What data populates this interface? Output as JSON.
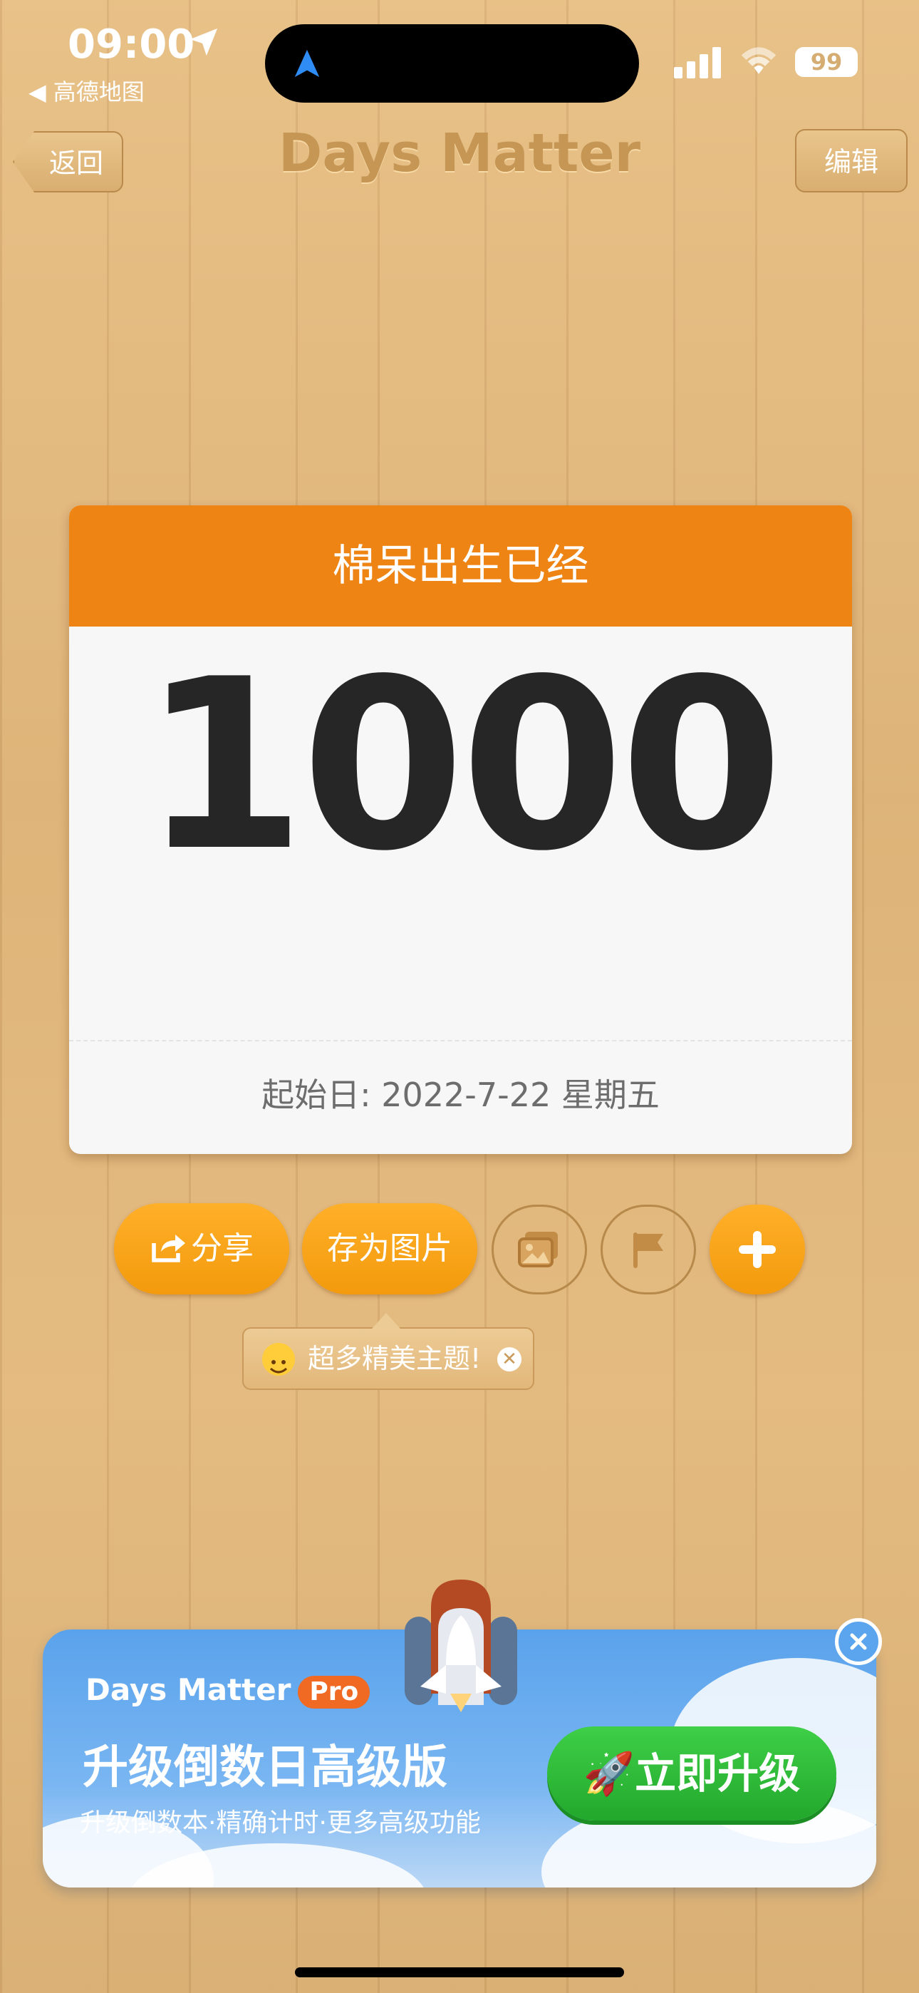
{
  "status": {
    "time": "09:00",
    "back_app": "◀ 高德地图",
    "battery": "99",
    "icons": [
      "location-arrow-icon",
      "navigation-icon",
      "signal-icon",
      "wifi-icon",
      "battery-icon"
    ]
  },
  "nav": {
    "back_label": "返回",
    "title": "Days Matter",
    "edit_label": "编辑"
  },
  "card": {
    "header": "棉呆出生已经",
    "days": "1000",
    "start_date": "起始日: 2022-7-22 星期五",
    "header_color": "#ee8414"
  },
  "actions": {
    "share_label": "分享",
    "save_image_label": "存为图片",
    "icons": [
      "share-icon",
      "theme-image-icon",
      "flag-icon",
      "plus-icon"
    ]
  },
  "tooltip": {
    "text": "超多精美主题!",
    "close": "✕"
  },
  "promo": {
    "brand": "Days Matter",
    "badge": "Pro",
    "title": "升级倒数日高级版",
    "subtitle": "升级倒数本·精确计时·更多高级功能",
    "button": "🚀立即升级",
    "button_color": "#22a82c"
  }
}
